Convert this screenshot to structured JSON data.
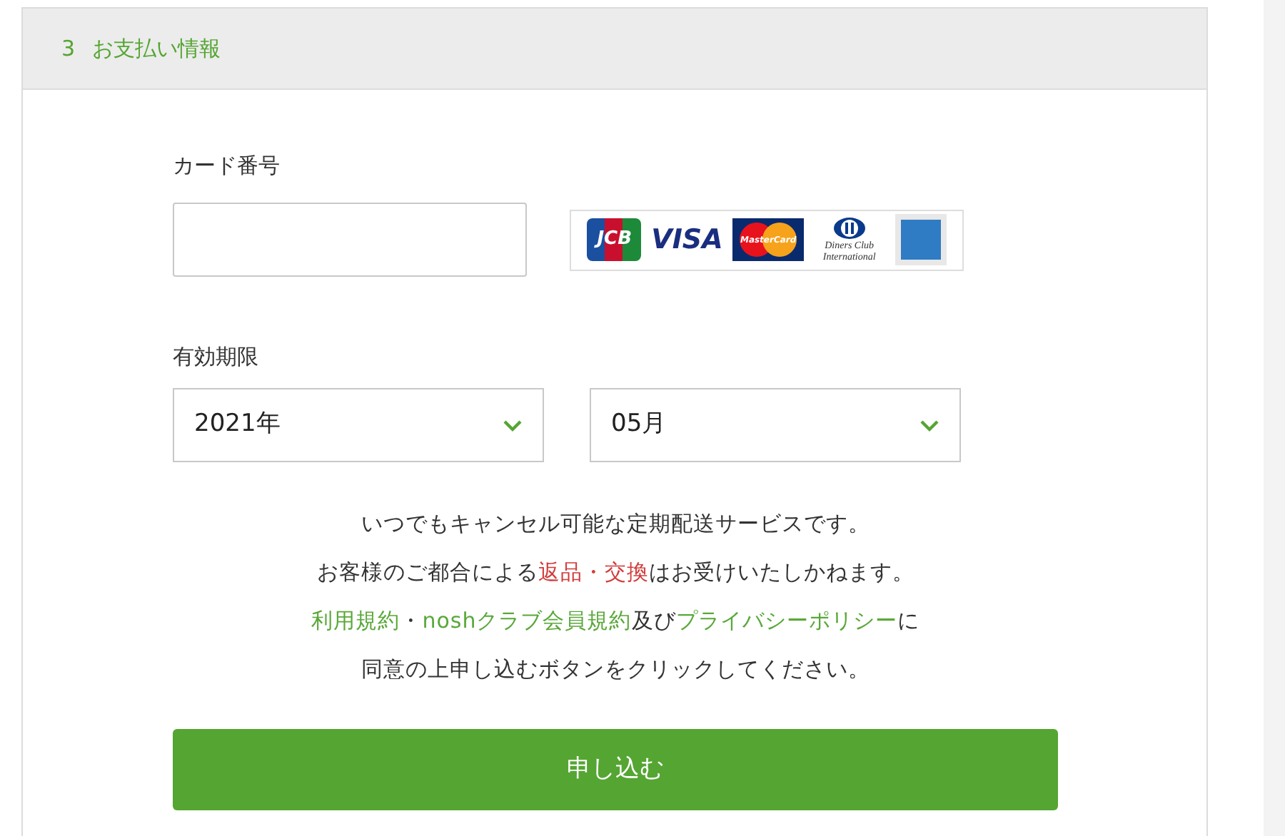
{
  "section": {
    "number": "3",
    "title": "お支払い情報"
  },
  "card_number": {
    "label": "カード番号"
  },
  "card_brands": [
    {
      "kind": "jcb",
      "text": "JCB"
    },
    {
      "kind": "visa",
      "text": "VISA"
    },
    {
      "kind": "mastercard",
      "text": "MasterCard"
    },
    {
      "kind": "diners",
      "text": "Diners Club International"
    },
    {
      "kind": "amex"
    }
  ],
  "expiry": {
    "label": "有効期限",
    "year": "2021年",
    "month": "05月"
  },
  "notice": [
    [
      {
        "kind": "plain",
        "text": "いつでもキャンセル可能な定期配送サービスです。"
      }
    ],
    [
      {
        "kind": "plain",
        "text": "お客様のご都合による"
      },
      {
        "kind": "alert",
        "text": "返品・交換"
      },
      {
        "kind": "plain",
        "text": "はお受けいたしかねます。"
      }
    ],
    [
      {
        "kind": "link",
        "text": "利用規約"
      },
      {
        "kind": "plain",
        "text": "・"
      },
      {
        "kind": "link",
        "text": "noshクラブ会員規約"
      },
      {
        "kind": "plain",
        "text": "及び"
      },
      {
        "kind": "link",
        "text": "プライバシーポリシー"
      },
      {
        "kind": "plain",
        "text": "に"
      }
    ],
    [
      {
        "kind": "plain",
        "text": "同意の上申し込むボタンをクリックしてください。"
      }
    ]
  ],
  "submit_button": "申し込む"
}
